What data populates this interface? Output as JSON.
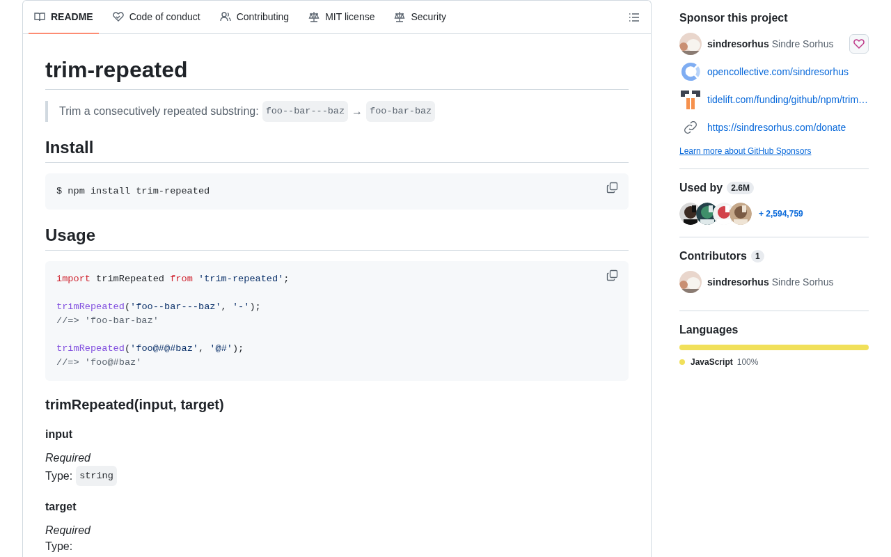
{
  "readme_tabs": [
    {
      "kind": "book",
      "label": "README",
      "selected": true
    },
    {
      "kind": "heart",
      "label": "Code of conduct",
      "selected": false
    },
    {
      "kind": "people",
      "label": "Contributing",
      "selected": false
    },
    {
      "kind": "scale",
      "label": "MIT license",
      "selected": false
    },
    {
      "kind": "scale",
      "label": "Security",
      "selected": false
    }
  ],
  "article": [
    {
      "kind": "h1",
      "text": "trim-repeated"
    },
    {
      "kind": "quote",
      "parts": [
        {
          "kind": "text",
          "text": "Trim a consecutively repeated substring:"
        },
        {
          "kind": "code",
          "text": "foo--bar---baz"
        },
        {
          "kind": "text",
          "text": "→"
        },
        {
          "kind": "code",
          "text": "foo-bar-baz"
        }
      ]
    },
    {
      "kind": "h2",
      "text": "Install"
    },
    {
      "kind": "code",
      "groups": [
        [
          [
            {
              "kind": "plain",
              "text": "$ npm install trim-repeated"
            }
          ]
        ]
      ]
    },
    {
      "kind": "h2",
      "text": "Usage"
    },
    {
      "kind": "code",
      "groups": [
        [
          [
            {
              "kind": "keyword",
              "text": "import"
            },
            {
              "kind": "plain",
              "text": " trimRepeated "
            },
            {
              "kind": "keyword",
              "text": "from"
            },
            {
              "kind": "string",
              "text": " 'trim-repeated'"
            },
            {
              "kind": "plain",
              "text": ";"
            }
          ]
        ],
        [
          [
            {
              "kind": "function",
              "text": "trimRepeated"
            },
            {
              "kind": "plain",
              "text": "("
            },
            {
              "kind": "string",
              "text": "'foo--bar---baz'"
            },
            {
              "kind": "plain",
              "text": ", "
            },
            {
              "kind": "string",
              "text": "'-'"
            },
            {
              "kind": "plain",
              "text": ");"
            }
          ],
          [
            {
              "kind": "comment",
              "text": "//=> 'foo-bar-baz'"
            }
          ]
        ],
        [
          [
            {
              "kind": "function",
              "text": "trimRepeated"
            },
            {
              "kind": "plain",
              "text": "("
            },
            {
              "kind": "string",
              "text": "'foo@#@#baz'"
            },
            {
              "kind": "plain",
              "text": ", "
            },
            {
              "kind": "string",
              "text": "'@#'"
            },
            {
              "kind": "plain",
              "text": ");"
            }
          ],
          [
            {
              "kind": "comment",
              "text": "//=> 'foo@#baz'"
            }
          ]
        ]
      ]
    },
    {
      "kind": "h3",
      "text": "trimRepeated(input, target)"
    },
    {
      "kind": "h4",
      "text": "input"
    },
    {
      "kind": "para",
      "lines": [
        [
          {
            "kind": "em",
            "text": "Required"
          }
        ],
        [
          {
            "kind": "text",
            "text": "Type:"
          },
          {
            "kind": "code",
            "text": "string"
          }
        ]
      ]
    },
    {
      "kind": "h4",
      "text": "target"
    },
    {
      "kind": "para",
      "lines": [
        [
          {
            "kind": "em",
            "text": "Required"
          }
        ],
        [
          {
            "kind": "text",
            "text": "Type:"
          }
        ]
      ]
    }
  ],
  "sidebar": {
    "sponsor": {
      "title": "Sponsor this project",
      "user": {
        "login": "sindresorhus",
        "name": "Sindre Sorhus"
      },
      "links": [
        {
          "kind": "opencollective",
          "text": "opencollective.com/sindresorhus"
        },
        {
          "kind": "tidelift",
          "text": "tidelift.com/funding/github/npm/trim…"
        },
        {
          "kind": "link",
          "text": "https://sindresorhus.com/donate"
        }
      ],
      "learn_more": "Learn more about GitHub Sponsors"
    },
    "used_by": {
      "title": "Used by",
      "count": "2.6M",
      "more": "+ 2,594,759"
    },
    "contributors": {
      "title": "Contributors",
      "count": "1",
      "people": [
        {
          "login": "sindresorhus",
          "name": "Sindre Sorhus"
        }
      ]
    },
    "languages": {
      "title": "Languages",
      "items": [
        {
          "name": "JavaScript",
          "percent": "100%",
          "color": "#f1e05a",
          "level": 1
        }
      ]
    }
  }
}
